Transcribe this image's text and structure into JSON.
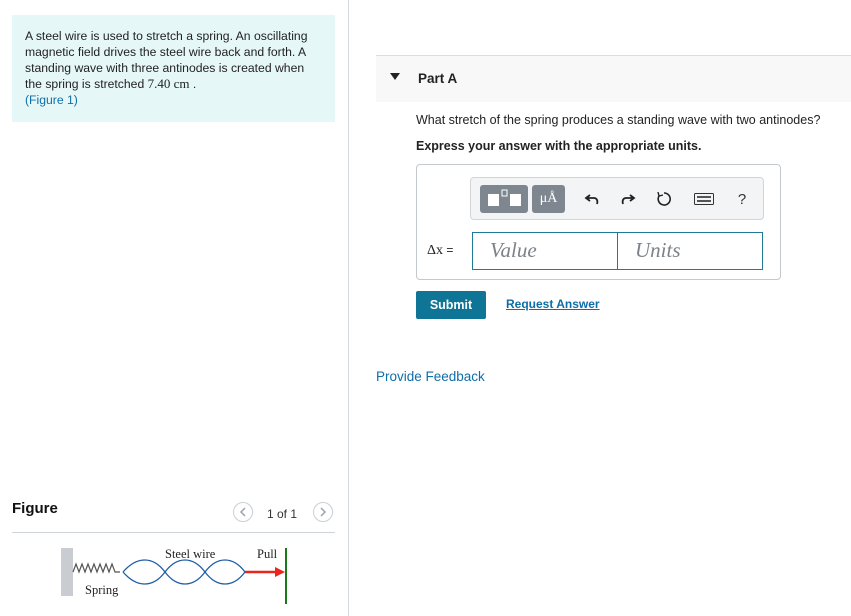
{
  "problem": {
    "text_before": "A steel wire is used to stretch a spring. An oscillating magnetic field drives the steel wire back and forth. A standing wave with three antinodes is created when the spring is stretched ",
    "value": "7.40 cm",
    "text_after": " .",
    "figure_link": "(Figure 1)"
  },
  "figure": {
    "title": "Figure",
    "page_indicator": "1 of 1",
    "prev_icon": "chevron-left-icon",
    "next_icon": "chevron-right-icon",
    "labels": {
      "steel_wire": "Steel wire",
      "pull": "Pull",
      "spring": "Spring"
    },
    "colors": {
      "wave": "#1f5ea8",
      "arrow": "#e8261c",
      "pole": "#1a7a1a"
    }
  },
  "part": {
    "title": "Part A",
    "question": "What stretch of the spring produces a standing wave with two antinodes?",
    "instruction": "Express your answer with the appropriate units."
  },
  "toolbar": {
    "templates_icon": "templates-icon",
    "symbols_label": "μÅ",
    "undo_icon": "undo-icon",
    "redo_icon": "redo-icon",
    "reset_icon": "reset-icon",
    "keyboard_icon": "keyboard-icon",
    "help_label": "?"
  },
  "answer": {
    "label_var": "Δx",
    "label_eq": " =",
    "value_placeholder": "Value",
    "units_placeholder": "Units"
  },
  "actions": {
    "submit_label": "Submit",
    "request_answer_label": "Request Answer",
    "feedback_label": "Provide Feedback"
  },
  "colors": {
    "accent": "#0e7596",
    "link": "#0e6ea8",
    "problem_bg": "#e6f7f8"
  }
}
